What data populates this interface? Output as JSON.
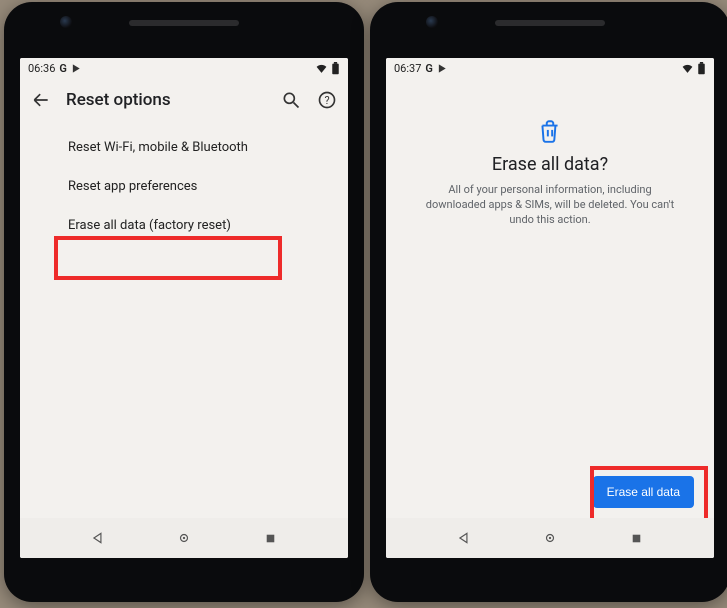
{
  "left": {
    "status": {
      "time": "06:36"
    },
    "appbar": {
      "title": "Reset options"
    },
    "items": [
      {
        "label": "Reset Wi-Fi, mobile & Bluetooth"
      },
      {
        "label": "Reset app preferences"
      },
      {
        "label": "Erase all data (factory reset)"
      }
    ]
  },
  "right": {
    "status": {
      "time": "06:37"
    },
    "erase": {
      "title": "Erase all data?",
      "body": "All of your personal information, including downloaded apps & SIMs, will be deleted. You can't undo this action.",
      "button": "Erase all data"
    }
  }
}
